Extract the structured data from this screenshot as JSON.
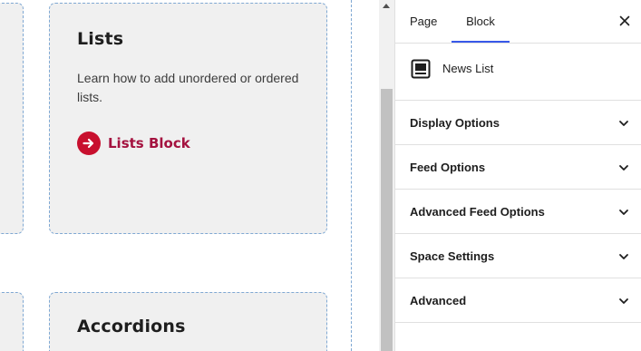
{
  "canvas": {
    "card_main": {
      "title": "Lists",
      "description": "Learn how to add unordered or ordered lists.",
      "link_label": "Lists Block"
    },
    "card_next": {
      "title": "Accordions"
    },
    "colors": {
      "link": "#a4123f",
      "link_icon": "#c8102e",
      "card_bg": "#f0f0f0",
      "dashed_border": "#7fa8d3"
    }
  },
  "sidebar": {
    "tabs": [
      {
        "label": "Page",
        "active": false
      },
      {
        "label": "Block",
        "active": true
      }
    ],
    "close_icon": "close-icon",
    "block": {
      "icon": "news-list-icon",
      "name": "News List"
    },
    "panels": [
      {
        "label": "Display Options"
      },
      {
        "label": "Feed Options"
      },
      {
        "label": "Advanced Feed Options"
      },
      {
        "label": "Space Settings"
      },
      {
        "label": "Advanced"
      }
    ],
    "accent_color": "#3858e9"
  }
}
